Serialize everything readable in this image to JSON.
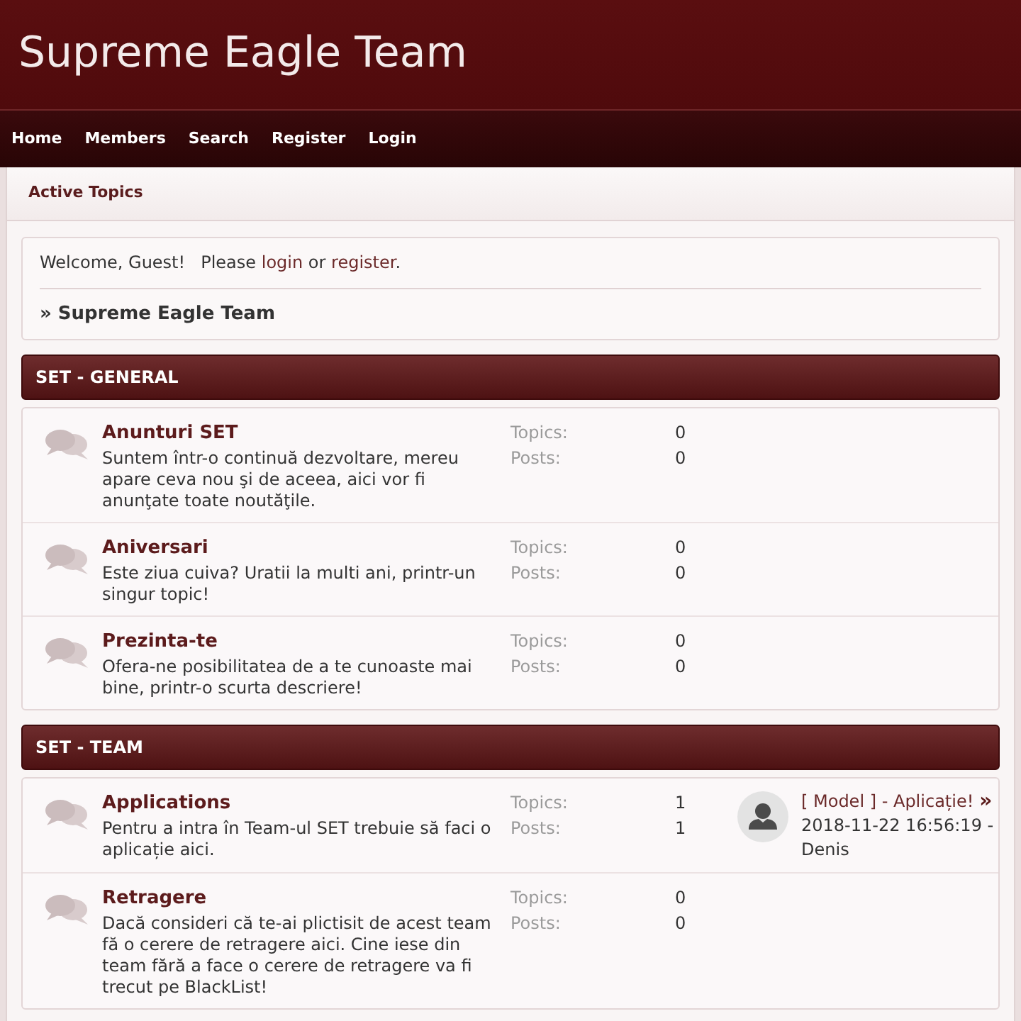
{
  "header": {
    "title": "Supreme Eagle Team"
  },
  "nav": [
    {
      "label": "Home"
    },
    {
      "label": "Members"
    },
    {
      "label": "Search"
    },
    {
      "label": "Register"
    },
    {
      "label": "Login"
    }
  ],
  "subnav": {
    "label": "Active Topics"
  },
  "welcome": {
    "greeting": "Welcome, Guest!",
    "prompt": "Please",
    "login_link": "login",
    "connector": "or",
    "register_link": "register",
    "end": "."
  },
  "breadcrumb": "» Supreme Eagle Team",
  "categories": [
    {
      "title": "SET - GENERAL",
      "forums": [
        {
          "title": "Anunturi SET",
          "description": "Suntem într-o continuă dezvoltare, mereu apare ceva nou şi de aceea, aici vor fi anunţate toate noutăţile.",
          "topics_label": "Topics:",
          "topics": "0",
          "posts_label": "Posts:",
          "posts": "0"
        },
        {
          "title": "Aniversari",
          "description": "Este ziua cuiva? Uratii la multi ani, printr-un singur topic!",
          "topics_label": "Topics:",
          "topics": "0",
          "posts_label": "Posts:",
          "posts": "0"
        },
        {
          "title": "Prezinta-te",
          "description": "Ofera-ne posibilitatea de a te cunoaste mai bine, printr-o scurta descriere!",
          "topics_label": "Topics:",
          "topics": "0",
          "posts_label": "Posts:",
          "posts": "0"
        }
      ]
    },
    {
      "title": "SET - TEAM",
      "forums": [
        {
          "title": "Applications",
          "description": "Pentru a intra în Team-ul SET trebuie să faci o aplicație aici.",
          "topics_label": "Topics:",
          "topics": "1",
          "posts_label": "Posts:",
          "posts": "1",
          "last_post": {
            "title": "[ Model ] - Aplicație!",
            "arrow": "»",
            "date": "2018-11-22 16:56:19 -",
            "author": "Denis"
          }
        },
        {
          "title": "Retragere",
          "description": "Dacă consideri că te-ai plictisit de acest team fă o cerere de retragere aici. Cine iese din team fără a face o cerere de retragere va fi trecut pe BlackList!",
          "topics_label": "Topics:",
          "topics": "0",
          "posts_label": "Posts:",
          "posts": "0"
        }
      ]
    }
  ]
}
